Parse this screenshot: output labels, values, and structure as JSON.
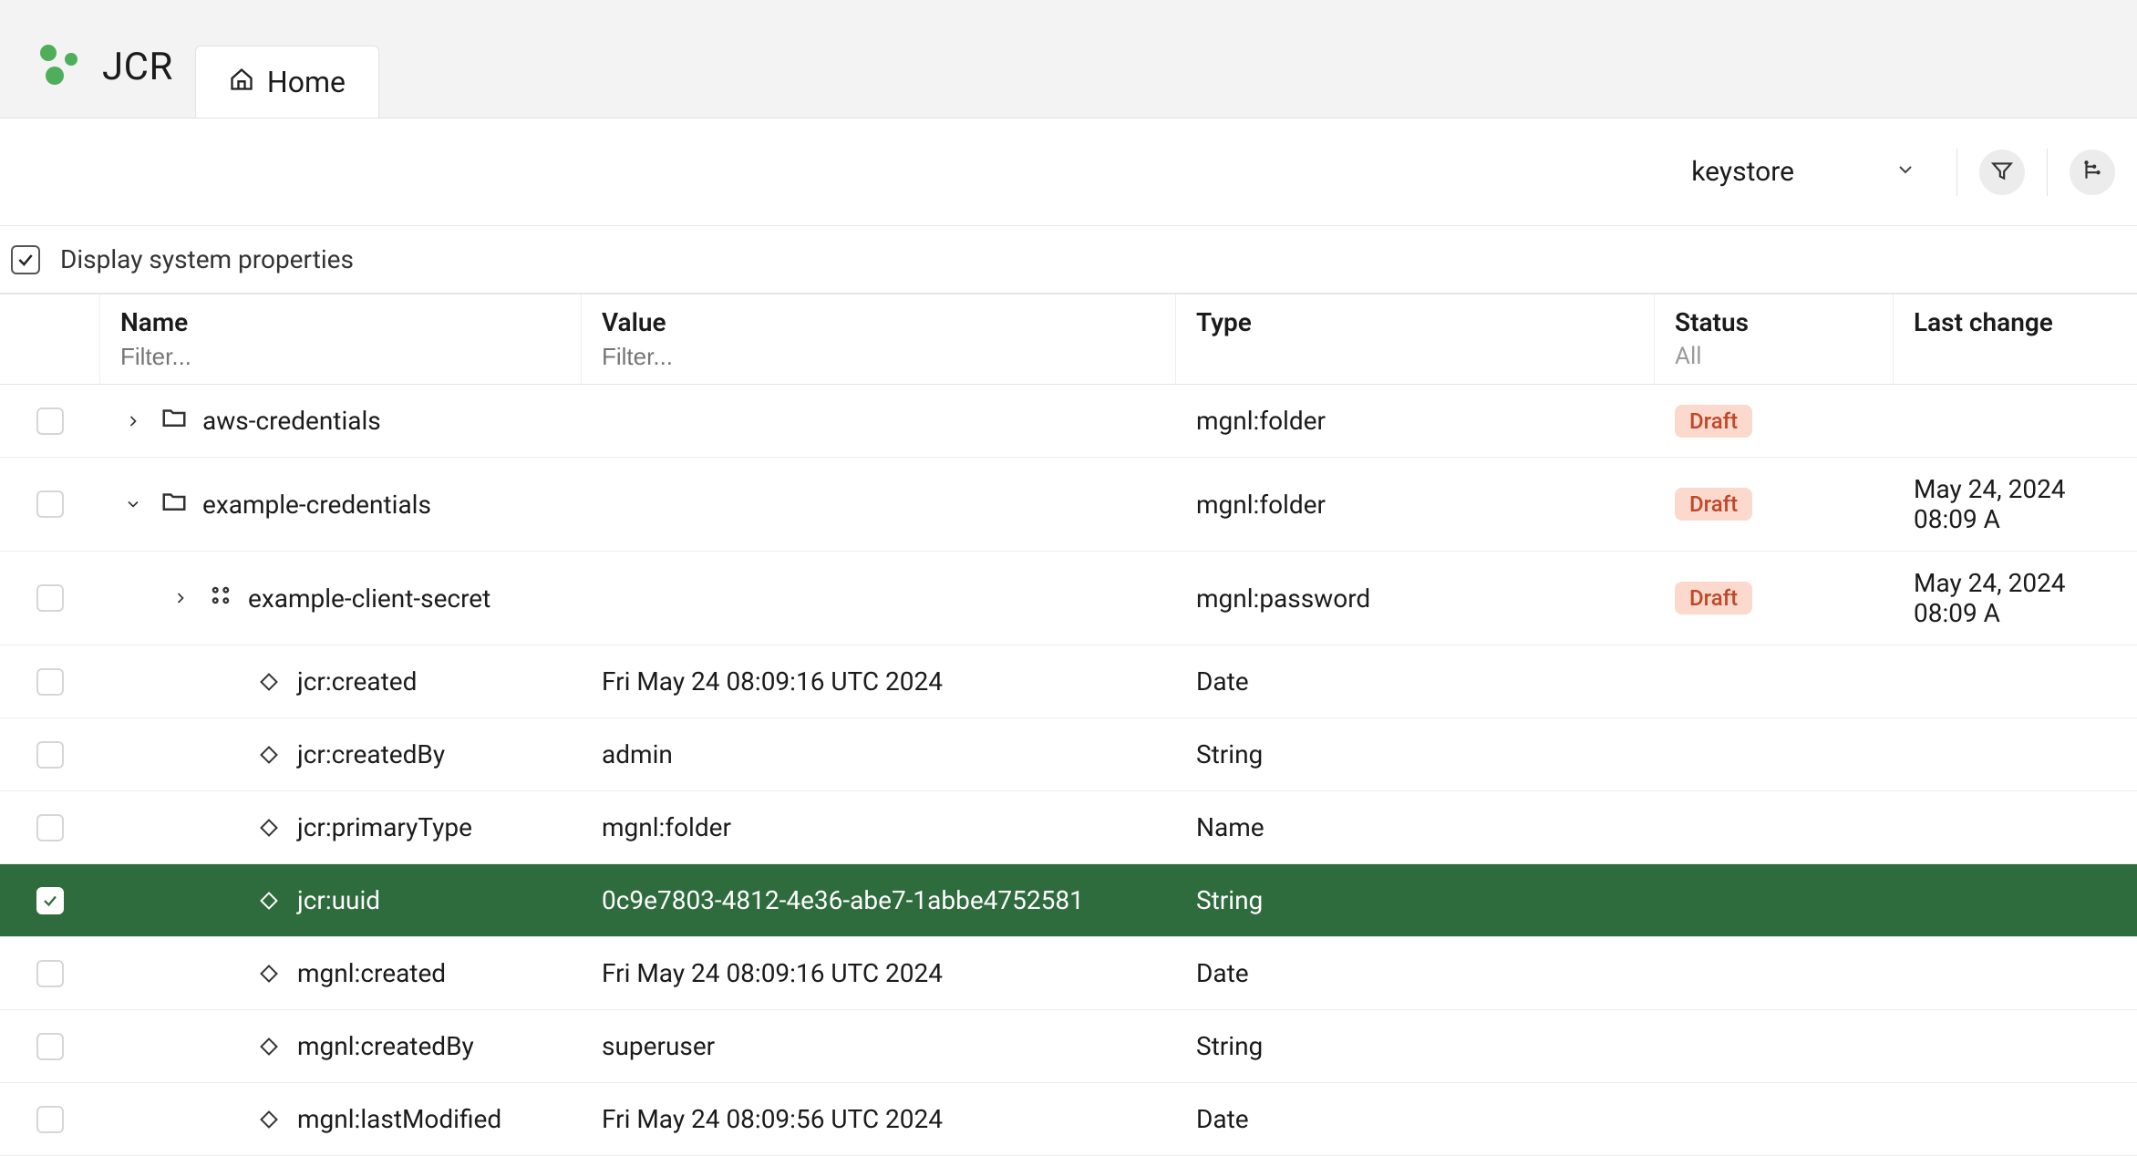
{
  "app": {
    "title": "JCR"
  },
  "tabs": [
    {
      "label": "Home"
    }
  ],
  "toolbar": {
    "workspace_selected": "keystore",
    "sysprops_label": "Display system properties",
    "sysprops_checked": true
  },
  "columns": {
    "name": "Name",
    "value": "Value",
    "type": "Type",
    "status": "Status",
    "last_change": "Last change",
    "name_filter_placeholder": "Filter...",
    "value_filter_placeholder": "Filter...",
    "status_filter": "All"
  },
  "rows": [
    {
      "checked": false,
      "indent": 0,
      "expander": "closed",
      "icon": "folder",
      "name": "aws-credentials",
      "value": "",
      "type": "mgnl:folder",
      "status": "Draft",
      "last": ""
    },
    {
      "checked": false,
      "indent": 0,
      "expander": "open",
      "icon": "folder",
      "name": "example-credentials",
      "value": "",
      "type": "mgnl:folder",
      "status": "Draft",
      "last": "May 24, 2024 08:09 A"
    },
    {
      "checked": false,
      "indent": 1,
      "expander": "closed",
      "icon": "dots",
      "name": "example-client-secret",
      "value": "",
      "type": "mgnl:password",
      "status": "Draft",
      "last": "May 24, 2024 08:09 A"
    },
    {
      "checked": false,
      "indent": 2,
      "expander": "none",
      "icon": "diamond",
      "name": "jcr:created",
      "value": "Fri May 24 08:09:16 UTC 2024",
      "type": "Date",
      "status": "",
      "last": ""
    },
    {
      "checked": false,
      "indent": 2,
      "expander": "none",
      "icon": "diamond",
      "name": "jcr:createdBy",
      "value": "admin",
      "type": "String",
      "status": "",
      "last": ""
    },
    {
      "checked": false,
      "indent": 2,
      "expander": "none",
      "icon": "diamond",
      "name": "jcr:primaryType",
      "value": "mgnl:folder",
      "type": "Name",
      "status": "",
      "last": ""
    },
    {
      "checked": true,
      "indent": 2,
      "expander": "none",
      "icon": "diamond",
      "name": "jcr:uuid",
      "value": "0c9e7803-4812-4e36-abe7-1abbe4752581",
      "type": "String",
      "status": "",
      "last": ""
    },
    {
      "checked": false,
      "indent": 2,
      "expander": "none",
      "icon": "diamond",
      "name": "mgnl:created",
      "value": "Fri May 24 08:09:16 UTC 2024",
      "type": "Date",
      "status": "",
      "last": ""
    },
    {
      "checked": false,
      "indent": 2,
      "expander": "none",
      "icon": "diamond",
      "name": "mgnl:createdBy",
      "value": "superuser",
      "type": "String",
      "status": "",
      "last": ""
    },
    {
      "checked": false,
      "indent": 2,
      "expander": "none",
      "icon": "diamond",
      "name": "mgnl:lastModified",
      "value": "Fri May 24 08:09:56 UTC 2024",
      "type": "Date",
      "status": "",
      "last": ""
    }
  ]
}
